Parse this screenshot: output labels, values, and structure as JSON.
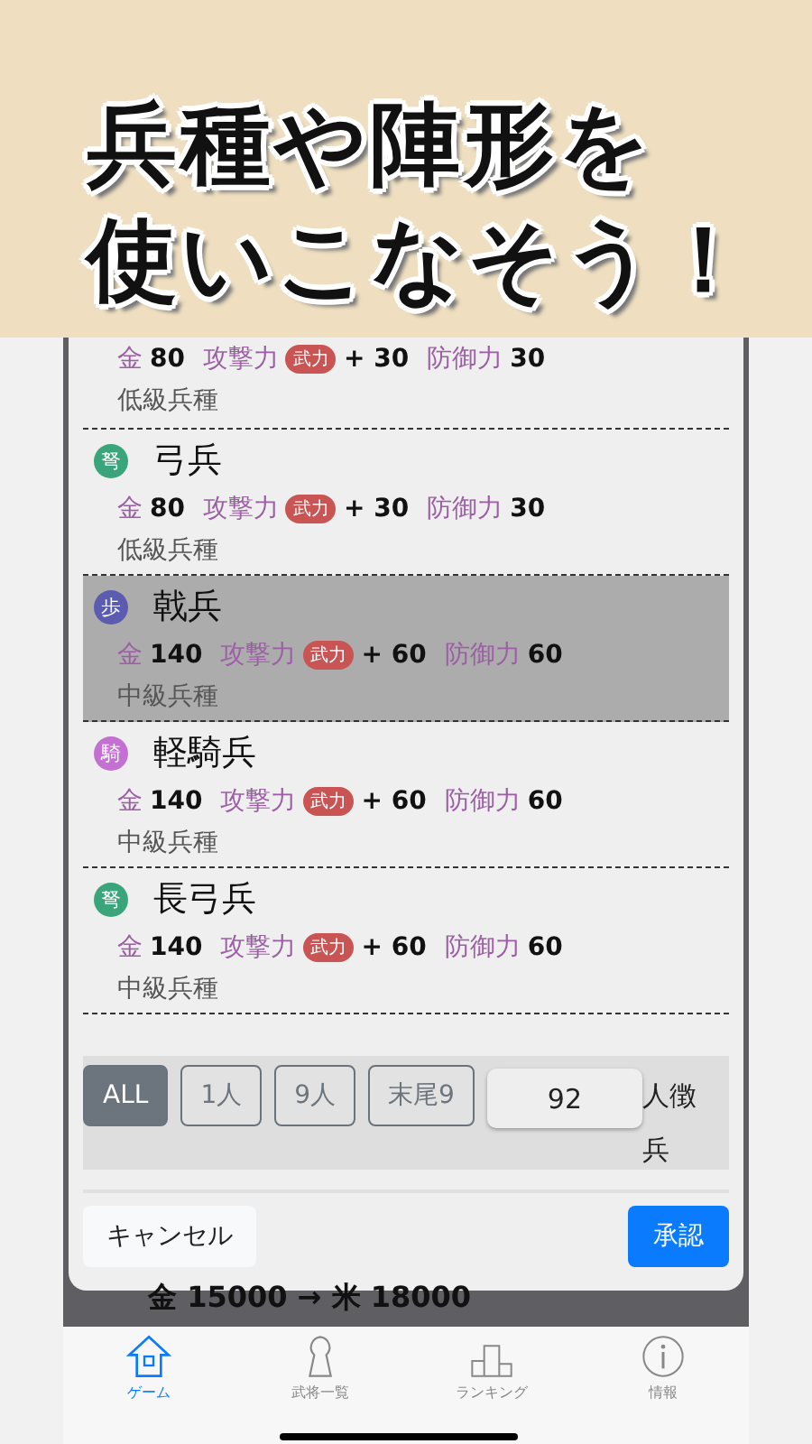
{
  "banner": {
    "lines": [
      "兵種や陣形を",
      "使いこなそう！"
    ]
  },
  "units": [
    {
      "selected": false,
      "gold_label": "金",
      "gold": "80",
      "attack_label": "攻撃力",
      "attack_badge": "武力",
      "attack_bonus": "+ 30",
      "defense_label": "防御力",
      "defense": "30",
      "grade": "低級兵種"
    },
    {
      "icon": "弩",
      "color": "#3aa57a",
      "name": "弓兵",
      "selected": false,
      "gold_label": "金",
      "gold": "80",
      "attack_label": "攻撃力",
      "attack_badge": "武力",
      "attack_bonus": "+ 30",
      "defense_label": "防御力",
      "defense": "30",
      "grade": "低級兵種"
    },
    {
      "icon": "歩",
      "color": "#5b5bb0",
      "name": "戟兵",
      "selected": true,
      "gold_label": "金",
      "gold": "140",
      "attack_label": "攻撃力",
      "attack_badge": "武力",
      "attack_bonus": "+ 60",
      "defense_label": "防御力",
      "defense": "60",
      "grade": "中級兵種"
    },
    {
      "icon": "騎",
      "color": "#c46fd2",
      "name": "軽騎兵",
      "selected": false,
      "gold_label": "金",
      "gold": "140",
      "attack_label": "攻撃力",
      "attack_badge": "武力",
      "attack_bonus": "+ 60",
      "defense_label": "防御力",
      "defense": "60",
      "grade": "中級兵種"
    },
    {
      "icon": "弩",
      "color": "#3aa57a",
      "name": "長弓兵",
      "selected": false,
      "gold_label": "金",
      "gold": "140",
      "attack_label": "攻撃力",
      "attack_badge": "武力",
      "attack_bonus": "+ 60",
      "defense_label": "防御力",
      "defense": "60",
      "grade": "中級兵種"
    }
  ],
  "filters": [
    {
      "label": "ALL",
      "selected": true
    },
    {
      "label": "1人",
      "selected": false
    },
    {
      "label": "9人",
      "selected": false
    },
    {
      "label": "末尾9",
      "selected": false
    }
  ],
  "count_field": {
    "value": "92"
  },
  "count_suffix": "人徴兵",
  "buttons": {
    "cancel": "キャンセル",
    "confirm": "承認"
  },
  "background_text": "金 15000 → 米 18000",
  "tabs": [
    {
      "label": "ゲーム",
      "kind": "home",
      "selected": true
    },
    {
      "label": "武将一覧",
      "kind": "figure",
      "selected": false
    },
    {
      "label": "ランキング",
      "kind": "podium",
      "selected": false
    },
    {
      "label": "情報",
      "kind": "info",
      "selected": false
    }
  ]
}
